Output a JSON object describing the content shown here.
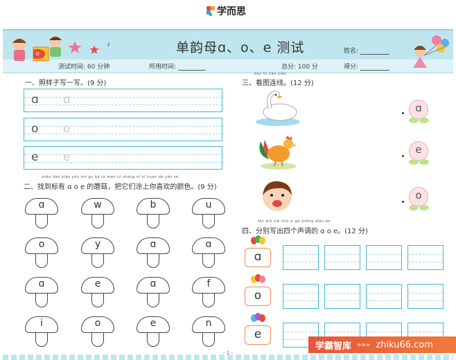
{
  "logo": {
    "text": "学而思"
  },
  "header": {
    "title": "单韵母ɑ、o、e 测试",
    "name_label": "姓名:",
    "test_time": "测试时间: 60 分钟",
    "used_time_label": "所用时间:",
    "total_score": "总分: 100 分",
    "score_label": "得分:",
    "badge_letter": "o"
  },
  "section1": {
    "title": "一、照样子写一写。(9 分)",
    "rows": [
      {
        "letter": "ɑ",
        "ghost": "ɑ"
      },
      {
        "letter": "o",
        "ghost": "o"
      },
      {
        "letter": "e",
        "ghost": "e"
      }
    ]
  },
  "section2": {
    "pinyin": "zhǎo dào biāo yǒu   mó gu   bǎ tā men tú shàng nǐ xǐ huan de yán sè",
    "title": "二、找到标有 ɑ o e 的蘑菇，把它们涂上你喜欢的颜色。(9 分)",
    "mushrooms": [
      "ɑ",
      "w",
      "b",
      "u",
      "o",
      "y",
      "ɑ",
      "ɑ",
      "ɑ",
      "e",
      "ɑ",
      "f",
      "i",
      "o",
      "e",
      "n"
    ]
  },
  "section3": {
    "pinyin": "kàn tú lián xiàn",
    "title": "三、看图连线。(12 分)",
    "peaches": [
      "ɑ",
      "e",
      "o"
    ]
  },
  "section4": {
    "pinyin": "fēn bié xiě chū sì gè shēng diào de",
    "title": "四、分别写出四个声调的 ɑ o e。(12 分)",
    "letters": [
      "ɑ",
      "o",
      "e"
    ]
  },
  "page_number": "- 1 -",
  "watermark": {
    "brand": "学霸智库",
    "site": "zhiku66.com"
  },
  "colors": {
    "banner": "#bfe6ef",
    "box_border": "#41b8cf",
    "letter_box": "#f08a4b",
    "watermark": "#e8553a"
  }
}
